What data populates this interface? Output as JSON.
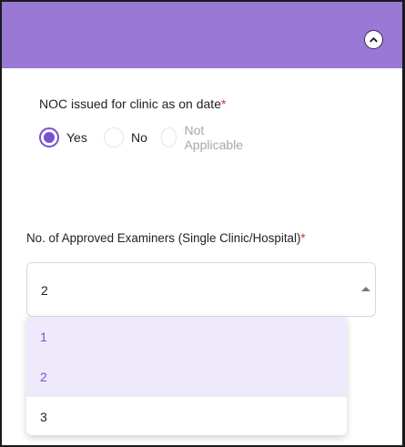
{
  "form": {
    "noc": {
      "label": "NOC issued for clinic as on date",
      "required_mark": "*",
      "options": [
        {
          "label": "Yes",
          "selected": true
        },
        {
          "label": "No",
          "selected": false
        },
        {
          "label": "Not Applicable",
          "selected": false
        }
      ]
    },
    "examiners": {
      "label": "No. of Approved Examiners (Single Clinic/Hospital)",
      "required_mark": "*",
      "selected_value": "2",
      "options": [
        "1",
        "2",
        "3"
      ]
    }
  },
  "colors": {
    "header": "#9a78d6",
    "accent": "#7a4fd0",
    "required": "#e02b2b",
    "option_highlight": "#efeafb"
  },
  "icons": {
    "collapse": "chevron-up-icon",
    "select_arrow": "caret-up-icon"
  }
}
